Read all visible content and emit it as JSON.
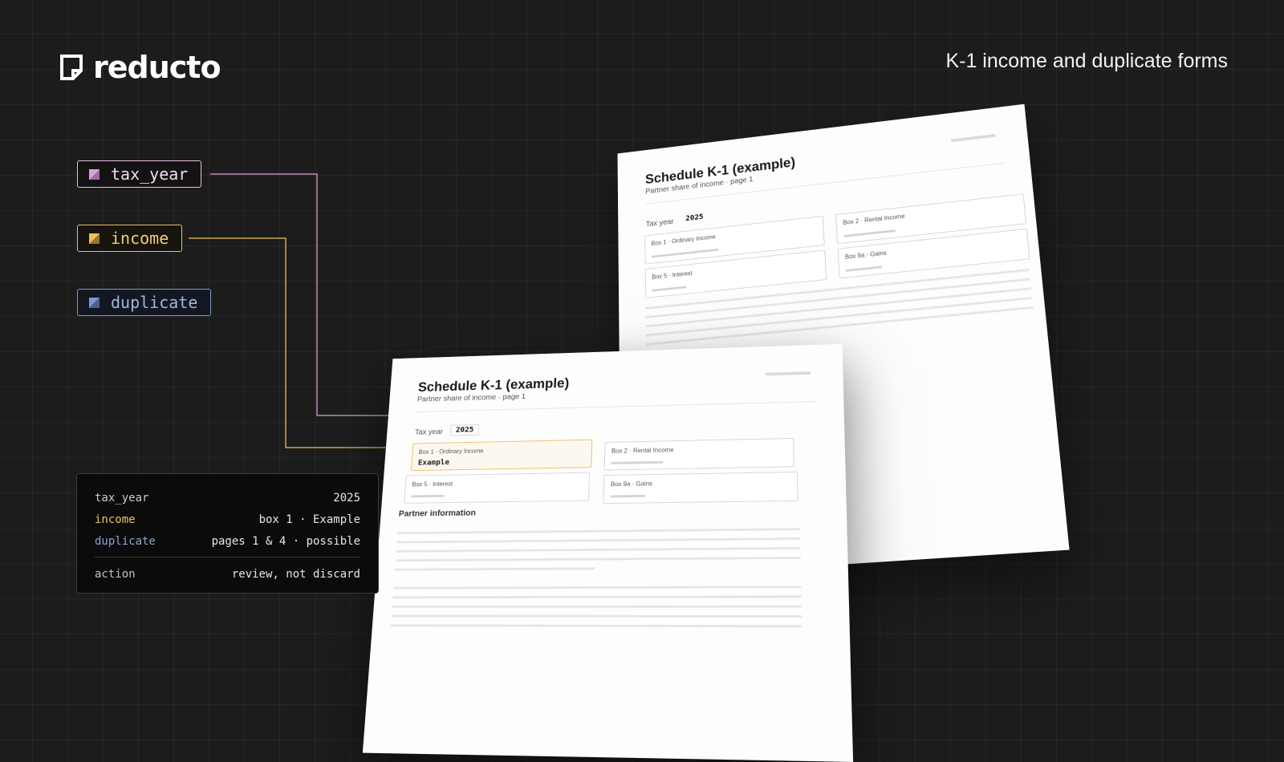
{
  "brand": {
    "name": "reducto"
  },
  "headline": "K-1 income and duplicate forms",
  "chips": [
    {
      "label": "tax_year",
      "color": "#e7bfe6"
    },
    {
      "label": "income",
      "color": "#efc060"
    },
    {
      "label": "duplicate",
      "color": "#7f97c9"
    }
  ],
  "doc_back": {
    "title": "Schedule K-1 (example)",
    "subtitle": "Partner share of income · page 1",
    "tax_year_label": "Tax year",
    "tax_year_value": "2025",
    "boxes": [
      "Box 1 · Ordinary Income",
      "Box 2 · Rental Income",
      "Box 5 · Interest",
      "Box 9a · Gains"
    ]
  },
  "doc_front": {
    "title": "Schedule K-1 (example)",
    "subtitle": "Partner share of income · page 1",
    "tax_year_label": "Tax year",
    "tax_year_value": "2025",
    "boxes": [
      "Box 1 · Ordinary Income",
      "Box 2 · Rental Income",
      "Box 5 · Interest",
      "Box 9a · Gains"
    ],
    "box1_value": "Example",
    "section": "Partner information"
  },
  "summary": {
    "rows": [
      {
        "key": "tax_year",
        "value": "2025"
      },
      {
        "key": "income",
        "value": "box 1 · Example"
      },
      {
        "key": "duplicate",
        "value": "pages 1 & 4 · possible"
      }
    ],
    "action": {
      "key": "action",
      "value": "review, not discard"
    }
  }
}
